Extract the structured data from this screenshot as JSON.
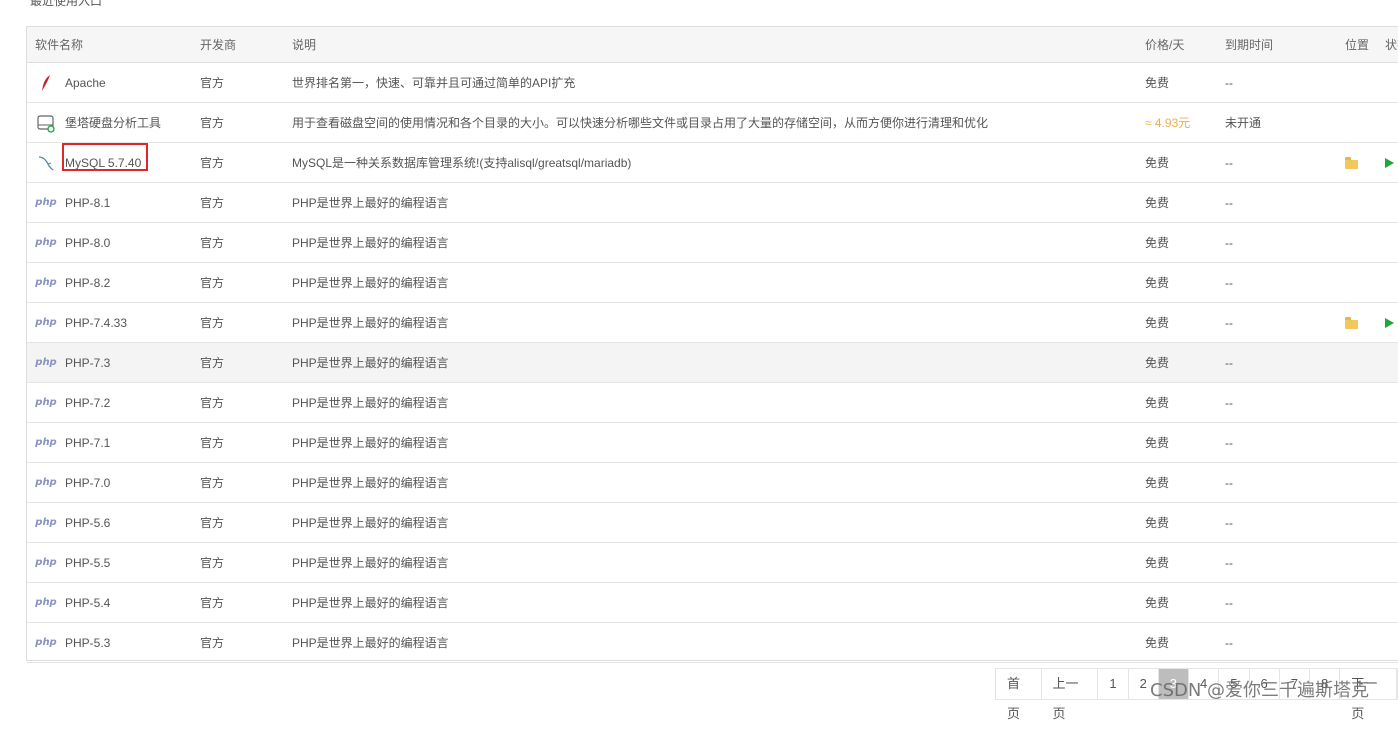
{
  "header_label": "最近使用入口",
  "columns": {
    "name": "软件名称",
    "developer": "开发商",
    "description": "说明",
    "price": "价格/天",
    "expire": "到期时间",
    "position": "位置",
    "status": "状态"
  },
  "rows": [
    {
      "icon": "feather-icon",
      "name": "Apache",
      "developer": "官方",
      "description": "世界排名第一，快速、可靠并且可通过简单的API扩充",
      "price": "免费",
      "expire": "--"
    },
    {
      "icon": "disk-analyzer-icon",
      "name": "堡塔硬盘分析工具",
      "developer": "官方",
      "description": "用于查看磁盘空间的使用情况和各个目录的大小。可以快速分析哪些文件或目录占用了大量的存储空间，从而方便你进行清理和优化",
      "price": "≈ 4.93元",
      "expire": "未开通"
    },
    {
      "icon": "mysql-dolphin-icon",
      "name": "MySQL 5.7.40",
      "developer": "官方",
      "description": "MySQL是一种关系数据库管理系统!(支持alisql/greatsql/mariadb)",
      "price": "免费",
      "expire": "--"
    },
    {
      "icon": "php-icon",
      "name": "PHP-8.1",
      "developer": "官方",
      "description": "PHP是世界上最好的编程语言",
      "price": "免费",
      "expire": "--"
    },
    {
      "icon": "php-icon",
      "name": "PHP-8.0",
      "developer": "官方",
      "description": "PHP是世界上最好的编程语言",
      "price": "免费",
      "expire": "--"
    },
    {
      "icon": "php-icon",
      "name": "PHP-8.2",
      "developer": "官方",
      "description": "PHP是世界上最好的编程语言",
      "price": "免费",
      "expire": "--"
    },
    {
      "icon": "php-icon",
      "name": "PHP-7.4.33",
      "developer": "官方",
      "description": "PHP是世界上最好的编程语言",
      "price": "免费",
      "expire": "--"
    },
    {
      "icon": "php-icon",
      "name": "PHP-7.3",
      "developer": "官方",
      "description": "PHP是世界上最好的编程语言",
      "price": "免费",
      "expire": "--"
    },
    {
      "icon": "php-icon",
      "name": "PHP-7.2",
      "developer": "官方",
      "description": "PHP是世界上最好的编程语言",
      "price": "免费",
      "expire": "--"
    },
    {
      "icon": "php-icon",
      "name": "PHP-7.1",
      "developer": "官方",
      "description": "PHP是世界上最好的编程语言",
      "price": "免费",
      "expire": "--"
    },
    {
      "icon": "php-icon",
      "name": "PHP-7.0",
      "developer": "官方",
      "description": "PHP是世界上最好的编程语言",
      "price": "免费",
      "expire": "--"
    },
    {
      "icon": "php-icon",
      "name": "PHP-5.6",
      "developer": "官方",
      "description": "PHP是世界上最好的编程语言",
      "price": "免费",
      "expire": "--"
    },
    {
      "icon": "php-icon",
      "name": "PHP-5.5",
      "developer": "官方",
      "description": "PHP是世界上最好的编程语言",
      "price": "免费",
      "expire": "--"
    },
    {
      "icon": "php-icon",
      "name": "PHP-5.4",
      "developer": "官方",
      "description": "PHP是世界上最好的编程语言",
      "price": "免费",
      "expire": "--"
    },
    {
      "icon": "php-icon",
      "name": "PHP-5.3",
      "developer": "官方",
      "description": "PHP是世界上最好的编程语言",
      "price": "免费",
      "expire": "--"
    }
  ],
  "php_icon_text": "php",
  "pagination": {
    "first": "首页",
    "prev": "上一页",
    "pages": [
      "1",
      "2",
      "3",
      "4",
      "5",
      "6",
      "7",
      "8"
    ],
    "current": "3",
    "next": "下一页"
  },
  "watermark": "CSDN @爱你三千遍斯塔克",
  "colors": {
    "paid_price": "#f0ad4e",
    "highlight_box": "#e0262a",
    "php_icon": "#8993be",
    "play": "#20a53a",
    "folder": "#f0c95b"
  }
}
